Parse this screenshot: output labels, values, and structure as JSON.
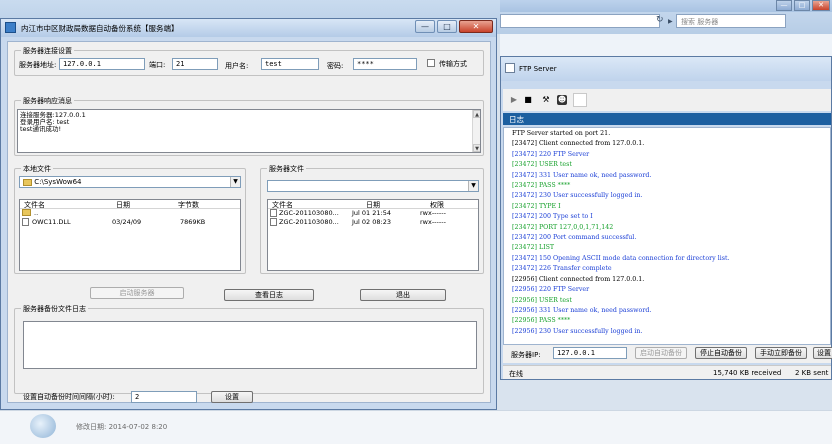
{
  "background": {
    "search_placeholder": "搜索 服务器",
    "modified_date": "修改日期: 2014-07-02 8:20"
  },
  "main_window": {
    "title": "内江市中区财政局数据自动备份系统【服务端】",
    "controls": {
      "minimize": "—",
      "maximize": "□",
      "close": "✕"
    },
    "connection_group": {
      "label": "服务器连接设置",
      "address_label": "服务器地址:",
      "address_value": "127.0.0.1",
      "port_label": "端口:",
      "port_value": "21",
      "user_label": "用户名:",
      "user_value": "test",
      "password_label": "密码:",
      "password_value": "****",
      "transfer_mode_label": "传输方式"
    },
    "response_group": {
      "label": "服务器响应消息",
      "lines": [
        "连接服务器:127.0.0.1",
        "登录用户名: test",
        "test通讯成功!"
      ]
    },
    "local_files": {
      "label": "本地文件",
      "path": "C:\\SysWow64",
      "columns": [
        "文件名",
        "日期",
        "字节数"
      ],
      "rows": [
        {
          "name": "..",
          "date": "",
          "size": ""
        },
        {
          "name": "OWC11.DLL",
          "date": "03/24/09",
          "size": "7869KB"
        }
      ]
    },
    "server_files": {
      "label": "服务器文件",
      "path": "",
      "columns": [
        "文件名",
        "日期",
        "权限"
      ],
      "rows": [
        {
          "name": "ZGC-201103080...",
          "date": "Jul 01 21:54",
          "perm": "rwx------"
        },
        {
          "name": "ZGC-201103080...",
          "date": "Jul 02 08:23",
          "perm": "rwx------"
        }
      ]
    },
    "buttons": {
      "start_server": "启动服务器",
      "view_log": "查看日志",
      "exit": "退出"
    },
    "backup_log_group": {
      "label": "服务器备份文件日志"
    },
    "interval": {
      "label": "设置自动备份时间间隔(小时):",
      "value": "2",
      "set_button": "设置"
    }
  },
  "ftp_window": {
    "title": "FTP Server",
    "log_tab": "日志",
    "log": [
      {
        "text": "FTP Server started on port 21.",
        "kind": "black"
      },
      {
        "text": "[23472] Client connected from 127.0.0.1.",
        "kind": "black"
      },
      {
        "text": "[23472] 220 FTP Server",
        "kind": "blue"
      },
      {
        "text": "[23472] USER test",
        "kind": "green"
      },
      {
        "text": "[23472] 331 User name ok, need password.",
        "kind": "blue"
      },
      {
        "text": "[23472] PASS ****",
        "kind": "green"
      },
      {
        "text": "[23472] 230 User successfully logged in.",
        "kind": "blue"
      },
      {
        "text": "[23472] TYPE I",
        "kind": "green"
      },
      {
        "text": "[23472] 200 Type set to I",
        "kind": "blue"
      },
      {
        "text": "[23472] PORT 127,0,0,1,71,142",
        "kind": "green"
      },
      {
        "text": "[23472] 200 Port command successful.",
        "kind": "blue"
      },
      {
        "text": "[23472] LIST",
        "kind": "green"
      },
      {
        "text": "[23472] 150 Opening ASCII mode data connection for directory list.",
        "kind": "blue"
      },
      {
        "text": "[23472] 226 Transfer complete",
        "kind": "blue"
      },
      {
        "text": "[22956] Client connected from 127.0.0.1.",
        "kind": "black"
      },
      {
        "text": "[22956] 220 FTP Server",
        "kind": "blue"
      },
      {
        "text": "[22956] USER test",
        "kind": "green"
      },
      {
        "text": "[22956] 331 User name ok, need password.",
        "kind": "blue"
      },
      {
        "text": "[22956] PASS ****",
        "kind": "green"
      },
      {
        "text": "[22956] 230 User successfully logged in.",
        "kind": "blue"
      }
    ],
    "server_ip_label": "服务器IP:",
    "server_ip_value": "127.0.0.1",
    "buttons": {
      "start_auto": "启动自动备份",
      "stop_auto": "停止自动备份",
      "backup_now": "手动立即备份",
      "settings": "设置"
    },
    "status": {
      "state": "在线",
      "received": "15,740 KB received",
      "sent": "2 KB sent"
    }
  },
  "colors": {
    "log_black": "#000000",
    "log_blue": "#1a3ed6",
    "log_green": "#15a02a",
    "tab_blue": "#1c5fa0"
  }
}
